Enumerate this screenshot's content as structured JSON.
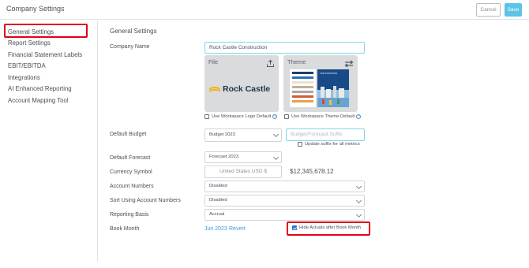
{
  "header": {
    "title": "Company Settings",
    "cancel_label": "Cancel",
    "save_label": "Save"
  },
  "sidebar": {
    "items": [
      {
        "label": "General Settings",
        "active": true
      },
      {
        "label": "Report Settings"
      },
      {
        "label": "Financial Statement Labels"
      },
      {
        "label": "EBIT/EBITDA"
      },
      {
        "label": "Integrations"
      },
      {
        "label": "AI Enhanced Reporting"
      },
      {
        "label": "Account Mapping Tool"
      }
    ]
  },
  "main": {
    "section_title": "General Settings",
    "company_name": {
      "label": "Company Name",
      "value": "Rock Castle Construction"
    },
    "file_card": {
      "title": "File",
      "logo_text": "Rock Castle",
      "icon": "upload-icon"
    },
    "theme_card": {
      "title": "Theme",
      "preview_title": "THE FOUNTAIN",
      "icon": "swap-icon"
    },
    "use_workspace_logo": {
      "label": "Use Workspace Logo Default",
      "checked": false
    },
    "use_workspace_theme": {
      "label": "Use Workspace Theme Default",
      "checked": false
    },
    "help_glyph": "?",
    "default_budget": {
      "label": "Default Budget",
      "value": "Budget 2023",
      "suffix_placeholder": "Budget/Forecast Suffix"
    },
    "update_suffix": {
      "label": "Update suffix for all metrics",
      "checked": false
    },
    "default_forecast": {
      "label": "Default Forecast",
      "value": "Forecast 2023"
    },
    "currency_symbol": {
      "label": "Currency Symbol",
      "placeholder": "United States USD $",
      "example": "$12,345,678.12"
    },
    "account_numbers": {
      "label": "Account Numbers",
      "value": "Disabled"
    },
    "sort_account_numbers": {
      "label": "Sort Using Account Numbers",
      "value": "Disabled"
    },
    "reporting_basis": {
      "label": "Reporting Basis",
      "value": "Accrual"
    },
    "book_month": {
      "label": "Book Month",
      "value": "Jun 2023",
      "revert_label": "Revert"
    },
    "hide_actuals": {
      "label": "Hide Actuals after Book Month",
      "checked": true
    }
  },
  "colors": {
    "accent": "#5ec3e8",
    "highlight": "#e2001a",
    "link": "#3a9ad9",
    "checkbox_checked": "#2f6fd1"
  }
}
